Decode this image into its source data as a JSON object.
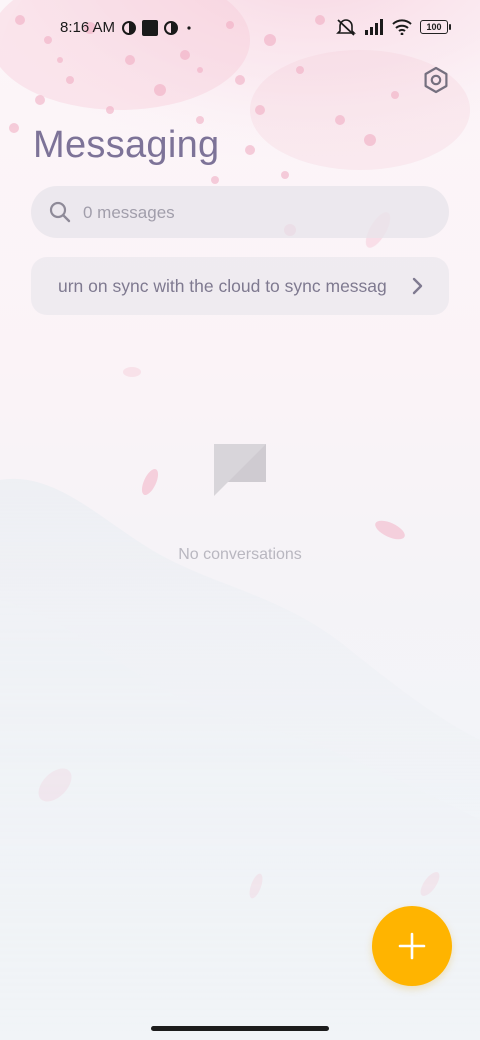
{
  "status_bar": {
    "time": "8:16 AM",
    "battery": "100",
    "icons": [
      "app-notification-icon",
      "square-notification-icon",
      "app-notification-icon",
      "dot-icon",
      "mute-icon",
      "signal-icon",
      "wifi-icon",
      "battery-icon"
    ]
  },
  "header": {
    "title": "Messaging",
    "settings_icon": "settings-hexagon-icon"
  },
  "search": {
    "placeholder": "0 messages",
    "value": ""
  },
  "sync_banner": {
    "text": "urn on sync with the cloud to sync messag",
    "icon": "chevron-right-icon"
  },
  "empty_state": {
    "icon": "message-bubble-icon",
    "text": "No conversations"
  },
  "fab": {
    "icon": "plus-icon",
    "color": "#ffb400"
  },
  "colors": {
    "title": "#7d7398",
    "accent": "#ffb400",
    "petal": "#f2b8cb"
  }
}
